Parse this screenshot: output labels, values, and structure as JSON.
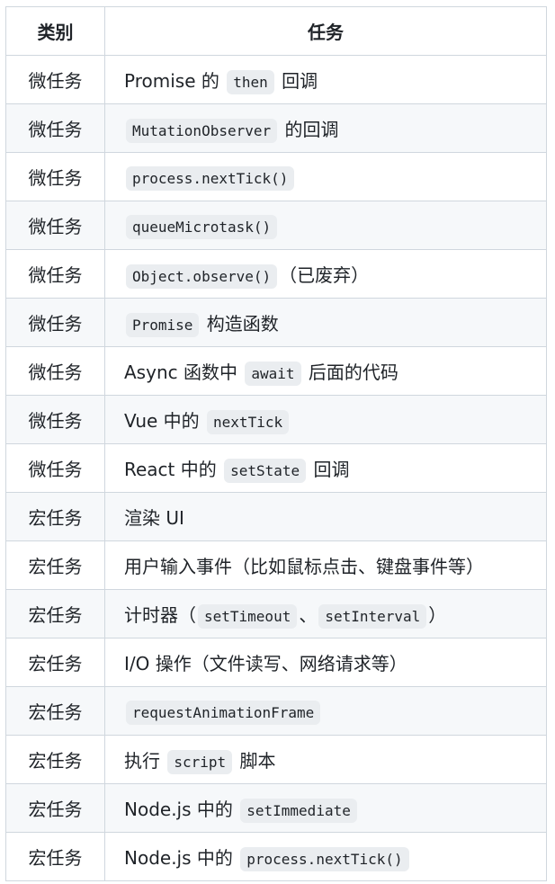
{
  "table": {
    "headers": {
      "category": "类别",
      "task": "任务"
    },
    "rows": [
      {
        "category": "微任务",
        "parts": [
          {
            "t": "Promise 的 "
          },
          {
            "c": "then"
          },
          {
            "t": " 回调"
          }
        ]
      },
      {
        "category": "微任务",
        "parts": [
          {
            "c": "MutationObserver"
          },
          {
            "t": " 的回调"
          }
        ]
      },
      {
        "category": "微任务",
        "parts": [
          {
            "c": "process.nextTick()"
          }
        ]
      },
      {
        "category": "微任务",
        "parts": [
          {
            "c": "queueMicrotask()"
          }
        ]
      },
      {
        "category": "微任务",
        "parts": [
          {
            "c": "Object.observe()"
          },
          {
            "t": "（已废弃）"
          }
        ]
      },
      {
        "category": "微任务",
        "parts": [
          {
            "c": "Promise"
          },
          {
            "t": " 构造函数"
          }
        ]
      },
      {
        "category": "微任务",
        "parts": [
          {
            "t": "Async 函数中 "
          },
          {
            "c": "await"
          },
          {
            "t": " 后面的代码"
          }
        ]
      },
      {
        "category": "微任务",
        "parts": [
          {
            "t": "Vue 中的 "
          },
          {
            "c": "nextTick"
          }
        ]
      },
      {
        "category": "微任务",
        "parts": [
          {
            "t": "React 中的 "
          },
          {
            "c": "setState"
          },
          {
            "t": " 回调"
          }
        ]
      },
      {
        "category": "宏任务",
        "parts": [
          {
            "t": "渲染 UI"
          }
        ]
      },
      {
        "category": "宏任务",
        "parts": [
          {
            "t": "用户输入事件（比如鼠标点击、键盘事件等）"
          }
        ]
      },
      {
        "category": "宏任务",
        "parts": [
          {
            "t": "计时器（"
          },
          {
            "c": "setTimeout"
          },
          {
            "t": "、"
          },
          {
            "c": "setInterval"
          },
          {
            "t": "）"
          }
        ]
      },
      {
        "category": "宏任务",
        "parts": [
          {
            "t": "I/O 操作（文件读写、网络请求等）"
          }
        ]
      },
      {
        "category": "宏任务",
        "parts": [
          {
            "c": "requestAnimationFrame"
          }
        ]
      },
      {
        "category": "宏任务",
        "parts": [
          {
            "t": "执行 "
          },
          {
            "c": "script"
          },
          {
            "t": " 脚本"
          }
        ]
      },
      {
        "category": "宏任务",
        "parts": [
          {
            "t": "Node.js 中的 "
          },
          {
            "c": "setImmediate"
          }
        ]
      },
      {
        "category": "宏任务",
        "parts": [
          {
            "t": "Node.js 中的 "
          },
          {
            "c": "process.nextTick()"
          }
        ]
      }
    ]
  }
}
